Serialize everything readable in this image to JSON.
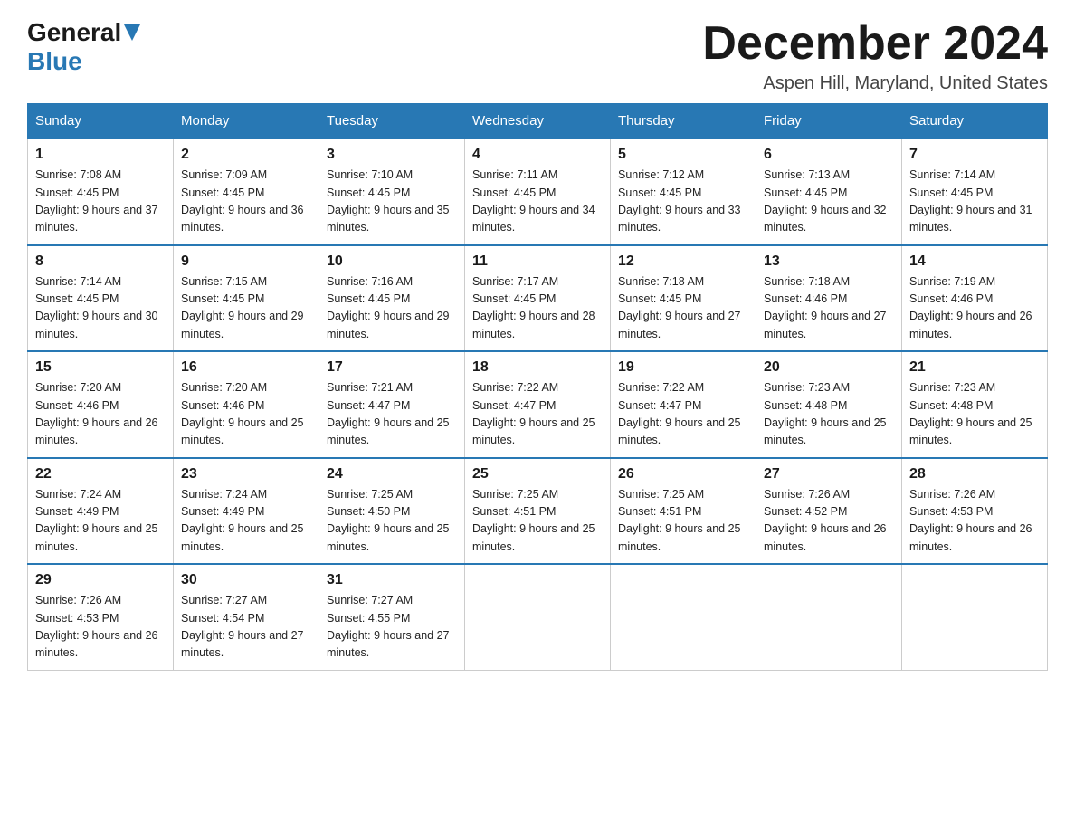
{
  "header": {
    "logo_general": "General",
    "logo_blue": "Blue",
    "month_title": "December 2024",
    "location": "Aspen Hill, Maryland, United States"
  },
  "days_of_week": [
    "Sunday",
    "Monday",
    "Tuesday",
    "Wednesday",
    "Thursday",
    "Friday",
    "Saturday"
  ],
  "weeks": [
    [
      {
        "day": "1",
        "sunrise": "7:08 AM",
        "sunset": "4:45 PM",
        "daylight": "9 hours and 37 minutes."
      },
      {
        "day": "2",
        "sunrise": "7:09 AM",
        "sunset": "4:45 PM",
        "daylight": "9 hours and 36 minutes."
      },
      {
        "day": "3",
        "sunrise": "7:10 AM",
        "sunset": "4:45 PM",
        "daylight": "9 hours and 35 minutes."
      },
      {
        "day": "4",
        "sunrise": "7:11 AM",
        "sunset": "4:45 PM",
        "daylight": "9 hours and 34 minutes."
      },
      {
        "day": "5",
        "sunrise": "7:12 AM",
        "sunset": "4:45 PM",
        "daylight": "9 hours and 33 minutes."
      },
      {
        "day": "6",
        "sunrise": "7:13 AM",
        "sunset": "4:45 PM",
        "daylight": "9 hours and 32 minutes."
      },
      {
        "day": "7",
        "sunrise": "7:14 AM",
        "sunset": "4:45 PM",
        "daylight": "9 hours and 31 minutes."
      }
    ],
    [
      {
        "day": "8",
        "sunrise": "7:14 AM",
        "sunset": "4:45 PM",
        "daylight": "9 hours and 30 minutes."
      },
      {
        "day": "9",
        "sunrise": "7:15 AM",
        "sunset": "4:45 PM",
        "daylight": "9 hours and 29 minutes."
      },
      {
        "day": "10",
        "sunrise": "7:16 AM",
        "sunset": "4:45 PM",
        "daylight": "9 hours and 29 minutes."
      },
      {
        "day": "11",
        "sunrise": "7:17 AM",
        "sunset": "4:45 PM",
        "daylight": "9 hours and 28 minutes."
      },
      {
        "day": "12",
        "sunrise": "7:18 AM",
        "sunset": "4:45 PM",
        "daylight": "9 hours and 27 minutes."
      },
      {
        "day": "13",
        "sunrise": "7:18 AM",
        "sunset": "4:46 PM",
        "daylight": "9 hours and 27 minutes."
      },
      {
        "day": "14",
        "sunrise": "7:19 AM",
        "sunset": "4:46 PM",
        "daylight": "9 hours and 26 minutes."
      }
    ],
    [
      {
        "day": "15",
        "sunrise": "7:20 AM",
        "sunset": "4:46 PM",
        "daylight": "9 hours and 26 minutes."
      },
      {
        "day": "16",
        "sunrise": "7:20 AM",
        "sunset": "4:46 PM",
        "daylight": "9 hours and 25 minutes."
      },
      {
        "day": "17",
        "sunrise": "7:21 AM",
        "sunset": "4:47 PM",
        "daylight": "9 hours and 25 minutes."
      },
      {
        "day": "18",
        "sunrise": "7:22 AM",
        "sunset": "4:47 PM",
        "daylight": "9 hours and 25 minutes."
      },
      {
        "day": "19",
        "sunrise": "7:22 AM",
        "sunset": "4:47 PM",
        "daylight": "9 hours and 25 minutes."
      },
      {
        "day": "20",
        "sunrise": "7:23 AM",
        "sunset": "4:48 PM",
        "daylight": "9 hours and 25 minutes."
      },
      {
        "day": "21",
        "sunrise": "7:23 AM",
        "sunset": "4:48 PM",
        "daylight": "9 hours and 25 minutes."
      }
    ],
    [
      {
        "day": "22",
        "sunrise": "7:24 AM",
        "sunset": "4:49 PM",
        "daylight": "9 hours and 25 minutes."
      },
      {
        "day": "23",
        "sunrise": "7:24 AM",
        "sunset": "4:49 PM",
        "daylight": "9 hours and 25 minutes."
      },
      {
        "day": "24",
        "sunrise": "7:25 AM",
        "sunset": "4:50 PM",
        "daylight": "9 hours and 25 minutes."
      },
      {
        "day": "25",
        "sunrise": "7:25 AM",
        "sunset": "4:51 PM",
        "daylight": "9 hours and 25 minutes."
      },
      {
        "day": "26",
        "sunrise": "7:25 AM",
        "sunset": "4:51 PM",
        "daylight": "9 hours and 25 minutes."
      },
      {
        "day": "27",
        "sunrise": "7:26 AM",
        "sunset": "4:52 PM",
        "daylight": "9 hours and 26 minutes."
      },
      {
        "day": "28",
        "sunrise": "7:26 AM",
        "sunset": "4:53 PM",
        "daylight": "9 hours and 26 minutes."
      }
    ],
    [
      {
        "day": "29",
        "sunrise": "7:26 AM",
        "sunset": "4:53 PM",
        "daylight": "9 hours and 26 minutes."
      },
      {
        "day": "30",
        "sunrise": "7:27 AM",
        "sunset": "4:54 PM",
        "daylight": "9 hours and 27 minutes."
      },
      {
        "day": "31",
        "sunrise": "7:27 AM",
        "sunset": "4:55 PM",
        "daylight": "9 hours and 27 minutes."
      },
      null,
      null,
      null,
      null
    ]
  ]
}
